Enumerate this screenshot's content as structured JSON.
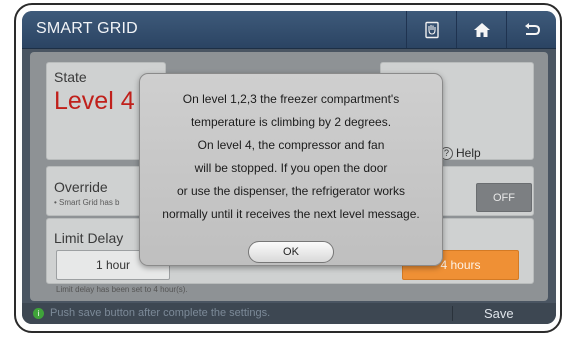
{
  "header": {
    "title": "SMART GRID",
    "buttons": [
      {
        "icon": "fridge-hand-icon"
      },
      {
        "icon": "home-icon"
      },
      {
        "icon": "back-icon"
      }
    ]
  },
  "state": {
    "label": "State",
    "value": "Level 4"
  },
  "help": {
    "label": "Help"
  },
  "override": {
    "label": "Override",
    "note": "• Smart Grid has b",
    "off_label": "OFF"
  },
  "limit_delay": {
    "label": "Limit Delay",
    "option_left": "1 hour",
    "option_right": "4 hours",
    "selected": "4 hours",
    "note": "Limit delay has been set to 4 hour(s)."
  },
  "bottom": {
    "hint": "Push save button after complete the settings.",
    "save_label": "Save"
  },
  "dialog": {
    "lines": [
      "On level 1,2,3 the freezer compartment's",
      "temperature is climbing by 2 degrees.",
      "On level 4, the compressor and fan",
      "will be stopped. If you open the door",
      "or use the dispenser, the refrigerator works",
      "normally until it receives the next level message."
    ],
    "ok_label": "OK"
  },
  "colors": {
    "header": "#2b4463",
    "state_value": "#c0201b",
    "selected_option": "#ef9035"
  }
}
